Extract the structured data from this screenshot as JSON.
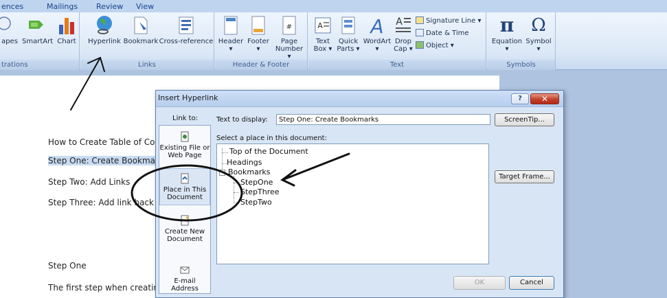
{
  "ribbon": {
    "tabs": [
      "ences",
      "Mailings",
      "Review",
      "View"
    ],
    "groups": {
      "illustrations": {
        "label": "trations",
        "buttons": [
          "apes",
          "SmartArt",
          "Chart"
        ]
      },
      "links": {
        "label": "Links",
        "buttons": [
          "Hyperlink",
          "Bookmark",
          "Cross-reference"
        ]
      },
      "header_footer": {
        "label": "Header & Footer",
        "buttons": [
          "Header",
          "Footer",
          "Page"
        ],
        "page_sub": "Number ▾"
      },
      "text": {
        "label": "Text",
        "buttons": [
          "Text",
          "Quick",
          "WordArt",
          "Drop"
        ],
        "text_sub": "Box ▾",
        "quick_sub": "Parts ▾",
        "drop_sub": "Cap ▾",
        "small_items": [
          "Signature Line ▾",
          "Date & Time",
          "Object ▾"
        ]
      },
      "symbols": {
        "label": "Symbols",
        "buttons": [
          "Equation",
          "Symbol"
        ]
      }
    }
  },
  "document": {
    "lines": [
      "How to Create Table of Con",
      "Step One: Create Bookmark",
      "Step Two: Add Links",
      "Step Three: Add link back to",
      "Step One",
      "The first step when creating"
    ]
  },
  "dialog": {
    "title": "Insert Hyperlink",
    "help_label": "?",
    "close_label": "✕",
    "link_to_label": "Link to:",
    "link_to_items": [
      "Existing File or Web Page",
      "Place in This Document",
      "Create New Document",
      "E-mail Address"
    ],
    "text_to_display_label": "Text to display:",
    "text_to_display_value": "Step One: Create Bookmarks",
    "screentip_label": "ScreenTip...",
    "select_place_label": "Select a place in this document:",
    "tree": {
      "top": "Top of the Document",
      "headings": "Headings",
      "bookmarks": "Bookmarks",
      "bookmark_items": [
        "StepOne",
        "StepThree",
        "StepTwo"
      ],
      "expander": "−"
    },
    "target_frame_label": "Target Frame...",
    "ok_label": "OK",
    "cancel_label": "Cancel"
  }
}
